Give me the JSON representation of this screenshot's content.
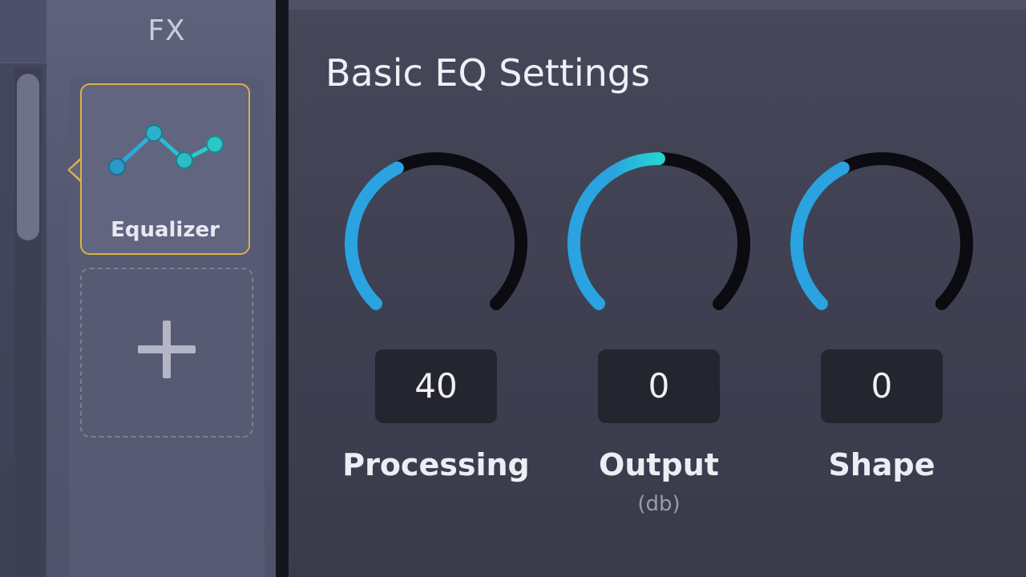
{
  "fx_panel": {
    "title": "FX",
    "effects": [
      {
        "label": "Equalizer",
        "icon": "equalizer-curve-icon",
        "selected": true
      }
    ],
    "add_button_icon": "plus-icon",
    "accent": "#d6b24a"
  },
  "settings": {
    "title": "Basic EQ Settings",
    "knobs": [
      {
        "label": "Processing",
        "value": "40",
        "unit": "",
        "level": 0.4
      },
      {
        "label": "Output",
        "value": "0",
        "unit": "(db)",
        "level": 0.5
      },
      {
        "label": "Shape",
        "value": "0",
        "unit": "",
        "level": 0.4
      }
    ],
    "colors": {
      "arc_fill": "#2aa3e0",
      "arc_fill_end": "#27d3d0",
      "arc_track": "#0b0b10"
    }
  }
}
